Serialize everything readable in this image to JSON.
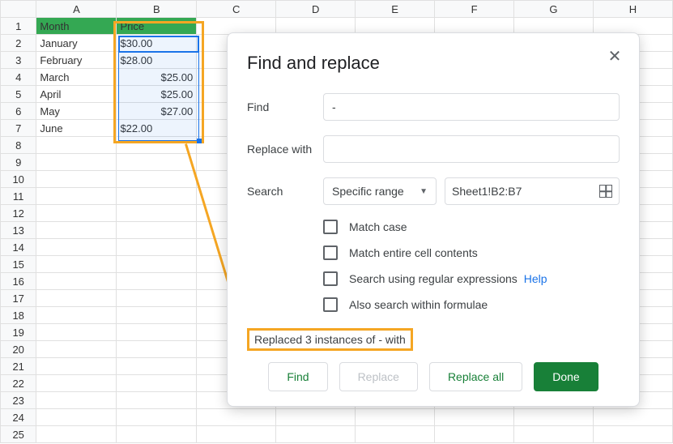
{
  "columns": [
    "A",
    "B",
    "C",
    "D",
    "E",
    "F",
    "G",
    "H"
  ],
  "rows_count": 25,
  "headers": {
    "a": "Month",
    "b": "Price"
  },
  "data": [
    {
      "month": "January",
      "price": "$30.00",
      "align": "left"
    },
    {
      "month": "February",
      "price": "$28.00",
      "align": "left"
    },
    {
      "month": "March",
      "price": "$25.00",
      "align": "right"
    },
    {
      "month": "April",
      "price": "$25.00",
      "align": "right"
    },
    {
      "month": "May",
      "price": "$27.00",
      "align": "right"
    },
    {
      "month": "June",
      "price": "$22.00",
      "align": "left"
    }
  ],
  "dialog": {
    "title": "Find and replace",
    "find_label": "Find",
    "find_value": "-",
    "replace_label": "Replace with",
    "replace_value": "",
    "search_label": "Search",
    "search_scope": "Specific range",
    "range_value": "Sheet1!B2:B7",
    "checks": {
      "match_case": "Match case",
      "match_entire": "Match entire cell contents",
      "regex": "Search using regular expressions",
      "help": "Help",
      "formulae": "Also search within formulae"
    },
    "status": "Replaced 3 instances of - with",
    "buttons": {
      "find": "Find",
      "replace": "Replace",
      "replace_all": "Replace all",
      "done": "Done"
    }
  }
}
